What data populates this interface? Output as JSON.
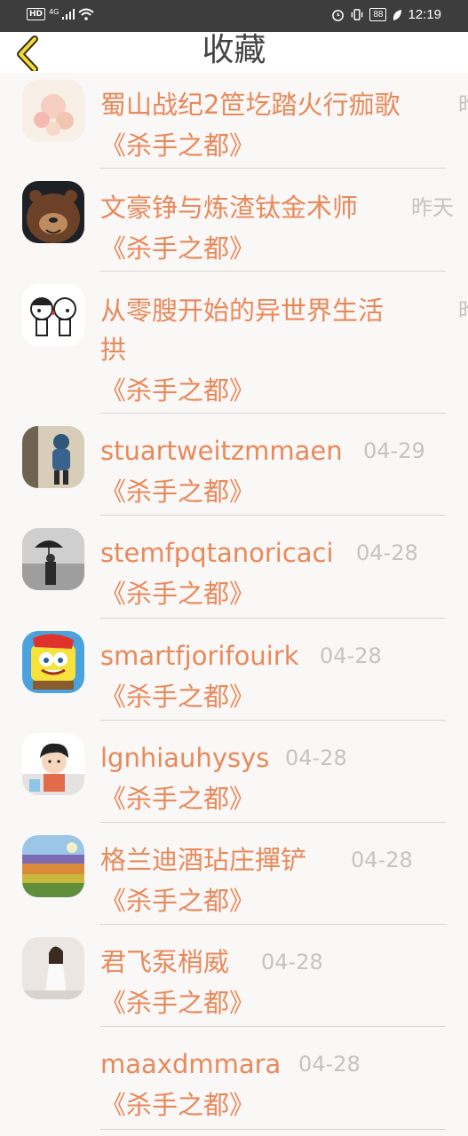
{
  "status_bar": {
    "hd": "HD",
    "network": "4G",
    "battery": "88",
    "time": "12:19"
  },
  "header": {
    "title": "收藏"
  },
  "items": [
    {
      "username": "蜀山战纪2笸圪踏火行痂歌",
      "date": "昨",
      "novel": "《杀手之都》"
    },
    {
      "username": "文豪铮与炼渣钛金术师",
      "date": "昨天",
      "novel": "《杀手之都》"
    },
    {
      "username_line1": "从零膄开始的异世界生活",
      "username_line2": "拱",
      "date": "昨",
      "novel": "《杀手之都》"
    },
    {
      "username": "stuartweitzmmaen",
      "date": "04-29",
      "novel": "《杀手之都》"
    },
    {
      "username": "stemfpqtanoricaci",
      "date": "04-28",
      "novel": "《杀手之都》"
    },
    {
      "username": "smartfjorifouirk",
      "date": "04-28",
      "novel": "《杀手之都》"
    },
    {
      "username": "lgnhiauhysys",
      "date": "04-28",
      "novel": "《杀手之都》"
    },
    {
      "username": "格兰迪酒玷庄撣铲",
      "date": "04-28",
      "novel": "《杀手之都》"
    },
    {
      "username": "君飞泵梢威",
      "date": "04-28",
      "novel": "《杀手之都》"
    },
    {
      "username": "maaxdmmara",
      "date": "04-28",
      "novel": "《杀手之都》"
    }
  ],
  "colors": {
    "accent": "#e8895a",
    "date": "#c4c4c4",
    "header_bg": "#ffffff",
    "status_bg": "#3d3d3d"
  }
}
